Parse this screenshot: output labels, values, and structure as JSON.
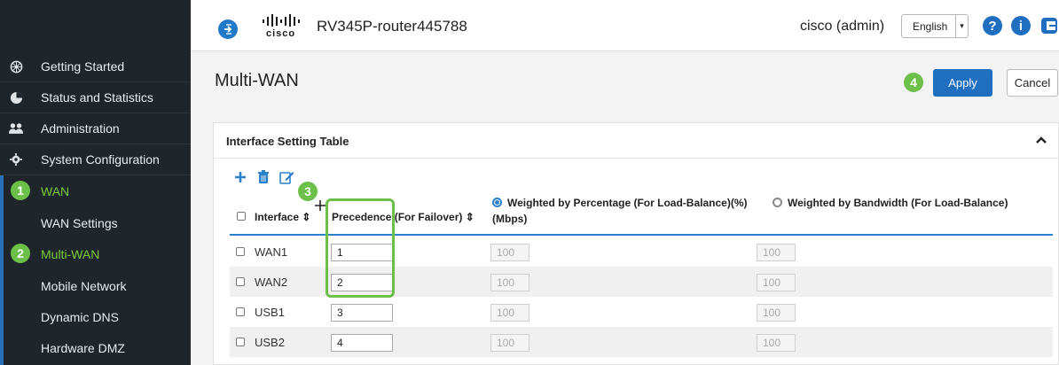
{
  "header": {
    "brand": "cisco",
    "device_name": "RV345P-router445788",
    "user": "cisco (admin)",
    "language": "English",
    "help_icon": "question-icon",
    "info_icon": "info-icon",
    "logout_icon": "logout-icon"
  },
  "sidebar": {
    "items": [
      {
        "label": "Getting Started",
        "icon": "gear-spoke-icon"
      },
      {
        "label": "Status and Statistics",
        "icon": "pie-chart-icon"
      },
      {
        "label": "Administration",
        "icon": "users-icon"
      },
      {
        "label": "System Configuration",
        "icon": "gear-icon"
      },
      {
        "label": "WAN",
        "badge": "1"
      },
      {
        "label": "WAN Settings"
      },
      {
        "label": "Multi-WAN",
        "badge": "2"
      },
      {
        "label": "Mobile Network"
      },
      {
        "label": "Dynamic DNS"
      },
      {
        "label": "Hardware DMZ"
      }
    ]
  },
  "page": {
    "title": "Multi-WAN",
    "apply_badge": "4",
    "apply_label": "Apply",
    "cancel_label": "Cancel"
  },
  "panel": {
    "title": "Interface Setting Table",
    "columns": {
      "interface": "Interface ⇕",
      "precedence": "Precedence (For Failover) ⇕",
      "weighted_percentage": "Weighted by Percentage (For Load-Balance)(%)",
      "mbps": "(Mbps)",
      "weighted_bandwidth": "Weighted by Bandwidth (For Load-Balance)"
    },
    "precedence_badge": "3",
    "rows": [
      {
        "interface": "WAN1",
        "precedence": "1",
        "percentage": "100",
        "bandwidth": "100"
      },
      {
        "interface": "WAN2",
        "precedence": "2",
        "percentage": "100",
        "bandwidth": "100"
      },
      {
        "interface": "USB1",
        "precedence": "3",
        "percentage": "100",
        "bandwidth": "100"
      },
      {
        "interface": "USB2",
        "precedence": "4",
        "percentage": "100",
        "bandwidth": "100"
      }
    ]
  },
  "colors": {
    "sidebar_bg": "#1e252b",
    "accent_blue": "#1f6ec0",
    "badge_green": "#6cc04a",
    "active_green": "#7bcb3b"
  }
}
